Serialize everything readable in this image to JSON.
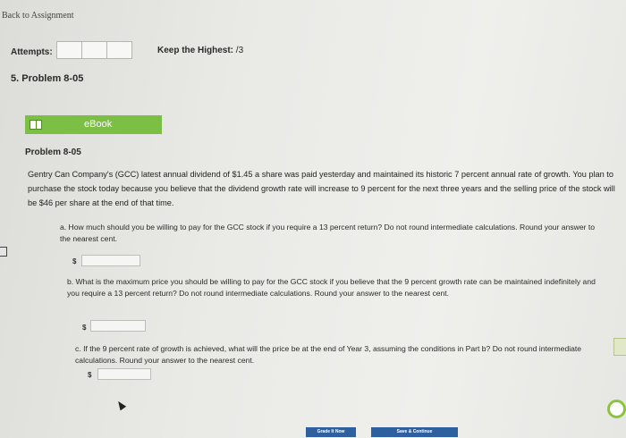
{
  "nav": {
    "back_label": "Back to Assignment"
  },
  "attempts": {
    "label": "Attempts:",
    "boxes": 3
  },
  "keep_highest": {
    "label": "Keep the Highest:",
    "value": "/3"
  },
  "problem_heading": "5. Problem 8-05",
  "ebook": {
    "label": "eBook",
    "icon": "book-icon"
  },
  "problem": {
    "title": "Problem 8-05",
    "text": "Gentry Can Company's (GCC) latest annual dividend of $1.45 a share was paid yesterday and maintained its historic 7 percent annual rate of growth. You plan to purchase the stock today because you believe that the dividend growth rate will increase to 9 percent for the next three years and the selling price of the stock will be $46 per share at the end of that time."
  },
  "parts": {
    "a": {
      "question": "a. How much should you be willing to pay for the GCC stock if you require a 13 percent return? Do not round intermediate calculations. Round your answer to the nearest cent.",
      "currency": "$",
      "value": ""
    },
    "b": {
      "question": "b. What is the maximum price you should be willing to pay for the GCC stock if you believe that the 9 percent growth rate can be maintained indefinitely and you require a 13 percent return? Do not round intermediate calculations. Round your answer to the nearest cent.",
      "currency": "$",
      "value": ""
    },
    "c": {
      "question": "c. If the 9 percent rate of growth is achieved, what will the price be at the end of Year 3, assuming the conditions in Part b? Do not round intermediate calculations. Round your answer to the nearest cent.",
      "currency": "$",
      "value": ""
    }
  },
  "footer": {
    "grade_label": "Grade It Now",
    "save_label": "Save & Continue"
  },
  "colors": {
    "ebook_green": "#7cbf45",
    "button_blue": "#2e5f9e"
  }
}
